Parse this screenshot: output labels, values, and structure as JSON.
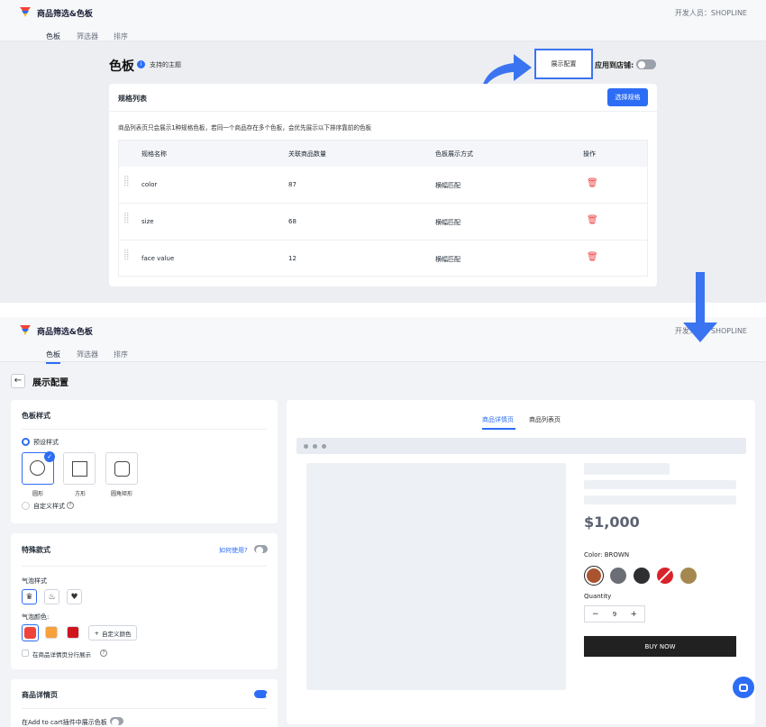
{
  "header": {
    "app_name": "商品筛选&色板",
    "developer": "开发人员：SHOPLINE",
    "tabs": [
      "色板",
      "筛选器",
      "排序"
    ]
  },
  "top_screen": {
    "page_title": "色板",
    "supported_themes": "支持的主题",
    "display_config_button": "展示配置",
    "apply_to_store_label": "应用到店铺:",
    "spec_list": {
      "title": "规格列表",
      "select_button": "选择规格",
      "description": "商品列表页只会展示1种规格色板，若同一个商品存在多个色板，会优先展示以下排序靠前的色板",
      "columns": [
        "规格名称",
        "关联商品数量",
        "色板展示方式",
        "操作"
      ],
      "rows": [
        {
          "name": "color",
          "count": "87",
          "mode": "横幅匹配"
        },
        {
          "name": "size",
          "count": "68",
          "mode": "横幅匹配"
        },
        {
          "name": "face value",
          "count": "12",
          "mode": "横幅匹配"
        }
      ]
    }
  },
  "bottom_screen": {
    "back_title": "展示配置",
    "swatch_style": {
      "title": "色板样式",
      "preset_label": "预设样式",
      "shapes": [
        "圆形",
        "方形",
        "圆角矩形"
      ],
      "custom_label": "自定义样式"
    },
    "special_style": {
      "title": "特殊款式",
      "how_to_use": "如何使用?",
      "bubble_style_label": "气泡样式",
      "bubble_color_label": "气泡颜色:",
      "bubble_colors": [
        "#f0433a",
        "#f7a03c",
        "#d0141e"
      ],
      "custom_color_button": "自定义颜色",
      "split_row_label": "在商品详情页分行展示"
    },
    "product_detail": {
      "title": "商品详情页",
      "add_to_cart_label": "在Add to cart插件中展示色板"
    },
    "preview": {
      "tabs": [
        "商品详情页",
        "商品列表页"
      ],
      "price": "$1,000",
      "color_label": "Color: BROWN",
      "colors": [
        "#a9532f",
        "#6b6f75",
        "#2e2f31",
        "#d8232a",
        "#a4884f"
      ],
      "quantity_label": "Quantity",
      "quantity_minus": "−",
      "quantity_value": "9",
      "quantity_plus": "+",
      "buy_now": "BUY NOW"
    }
  }
}
